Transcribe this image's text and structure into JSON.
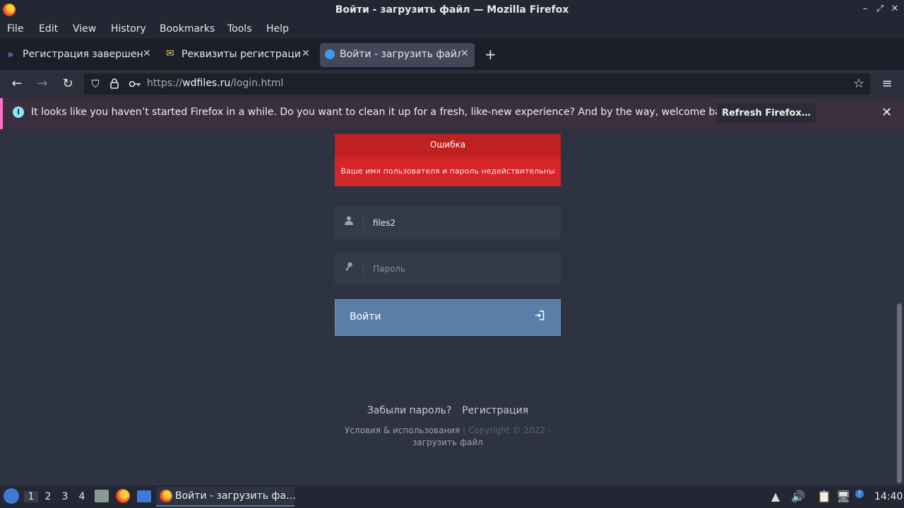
{
  "window": {
    "title": "Войти - загрузить файл — Mozilla Firefox",
    "controls": [
      "–",
      "⤢",
      "✕"
    ]
  },
  "menu": [
    "File",
    "Edit",
    "View",
    "History",
    "Bookmarks",
    "Tools",
    "Help"
  ],
  "tabs": [
    {
      "label": "Регистрация завершена",
      "icon": "chevrons-icon",
      "active": false
    },
    {
      "label": "Реквизиты регистрации",
      "icon": "mail-icon",
      "active": false
    },
    {
      "label": "Войти - загрузить файл",
      "icon": "cloud-icon",
      "active": true
    }
  ],
  "new_tab_label": "+",
  "url": {
    "scheme": "https://",
    "host": "wdfiles.ru",
    "path": "/login.html"
  },
  "notification": {
    "message": "It looks like you haven’t started Firefox in a while. Do you want to clean it up for a fresh, like-new experience? And by the way, welcome back!",
    "button": "Refresh Firefox…"
  },
  "page": {
    "error_title": "Ошибка",
    "error_message": "Ваше имя пользователя и пароль недействительны",
    "username_value": "files2",
    "password_placeholder": "Пароль",
    "login_button": "Войти",
    "forgot_link": "Забыли пароль?",
    "register_link": "Регистрация",
    "footer_terms": "Условия & использования",
    "footer_sep": "|",
    "footer_copyright": "Copyright © 2022 -",
    "footer_site": "загрузить файл"
  },
  "taskbar": {
    "workspaces": [
      "1",
      "2",
      "3",
      "4"
    ],
    "active_window": "Войти - загрузить фа…",
    "clock": "14:40"
  },
  "colors": {
    "error": "#d42626",
    "button": "#5b7ea9",
    "background": "#2d3340"
  }
}
